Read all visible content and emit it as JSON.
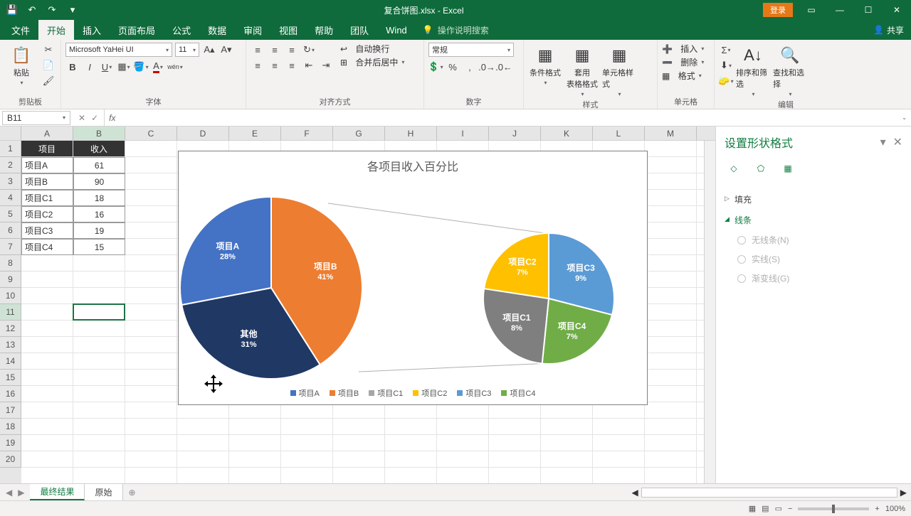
{
  "titlebar": {
    "filename": "复合饼图.xlsx - Excel",
    "login": "登录"
  },
  "tabs": {
    "file": "文件",
    "home": "开始",
    "insert": "插入",
    "pagelayout": "页面布局",
    "formulas": "公式",
    "data": "数据",
    "review": "审阅",
    "view": "视图",
    "help": "帮助",
    "team": "团队",
    "wind": "Wind",
    "tellme": "操作说明搜索",
    "share": "共享"
  },
  "ribbon": {
    "clipboard": {
      "label": "剪贴板",
      "paste": "粘贴"
    },
    "font": {
      "label": "字体",
      "name": "Microsoft YaHei UI",
      "size": "11"
    },
    "align": {
      "label": "对齐方式",
      "wrap": "自动换行",
      "merge": "合并后居中"
    },
    "number": {
      "label": "数字",
      "format": "常规"
    },
    "styles": {
      "label": "样式",
      "cond": "条件格式",
      "table": "套用\n表格格式",
      "cell": "单元格样式"
    },
    "cells": {
      "label": "单元格",
      "insert": "插入",
      "delete": "删除",
      "format": "格式"
    },
    "editing": {
      "label": "编辑",
      "sort": "排序和筛选",
      "find": "查找和选择"
    }
  },
  "namebox": "B11",
  "columns": [
    "A",
    "B",
    "C",
    "D",
    "E",
    "F",
    "G",
    "H",
    "I",
    "J",
    "K",
    "L",
    "M"
  ],
  "table": {
    "headers": [
      "项目",
      "收入"
    ],
    "rows": [
      [
        "项目A",
        "61"
      ],
      [
        "项目B",
        "90"
      ],
      [
        "项目C1",
        "18"
      ],
      [
        "项目C2",
        "16"
      ],
      [
        "项目C3",
        "19"
      ],
      [
        "项目C4",
        "15"
      ]
    ]
  },
  "chart_data": {
    "type": "pie",
    "title": "各项目收入百分比",
    "series": [
      {
        "name": "main",
        "slices": [
          {
            "label": "项目B",
            "pct": 41,
            "color": "#ed7d31"
          },
          {
            "label": "其他",
            "pct": 31,
            "color": "#203864"
          },
          {
            "label": "项目A",
            "pct": 28,
            "color": "#4472c4"
          }
        ]
      },
      {
        "name": "sub",
        "slices": [
          {
            "label": "项目C3",
            "pct": 9,
            "color": "#5b9bd5"
          },
          {
            "label": "项目C4",
            "pct": 7,
            "color": "#70ad47"
          },
          {
            "label": "项目C1",
            "pct": 8,
            "color": "#7f7f7f"
          },
          {
            "label": "项目C2",
            "pct": 7,
            "color": "#ffc000"
          }
        ]
      }
    ],
    "legend": [
      "项目A",
      "项目B",
      "项目C1",
      "项目C2",
      "项目C3",
      "项目C4"
    ],
    "legend_colors": [
      "#4472c4",
      "#ed7d31",
      "#a6a6a6",
      "#ffc000",
      "#5b9bd5",
      "#70ad47"
    ]
  },
  "sidepane": {
    "title": "设置形状格式",
    "fill": "填充",
    "line": "线条",
    "none": "无线条(N)",
    "solid": "实线(S)",
    "gradient": "渐变线(G)"
  },
  "sheets": {
    "active": "最终结果",
    "other": "原始"
  },
  "status": {
    "zoom": "100%"
  }
}
